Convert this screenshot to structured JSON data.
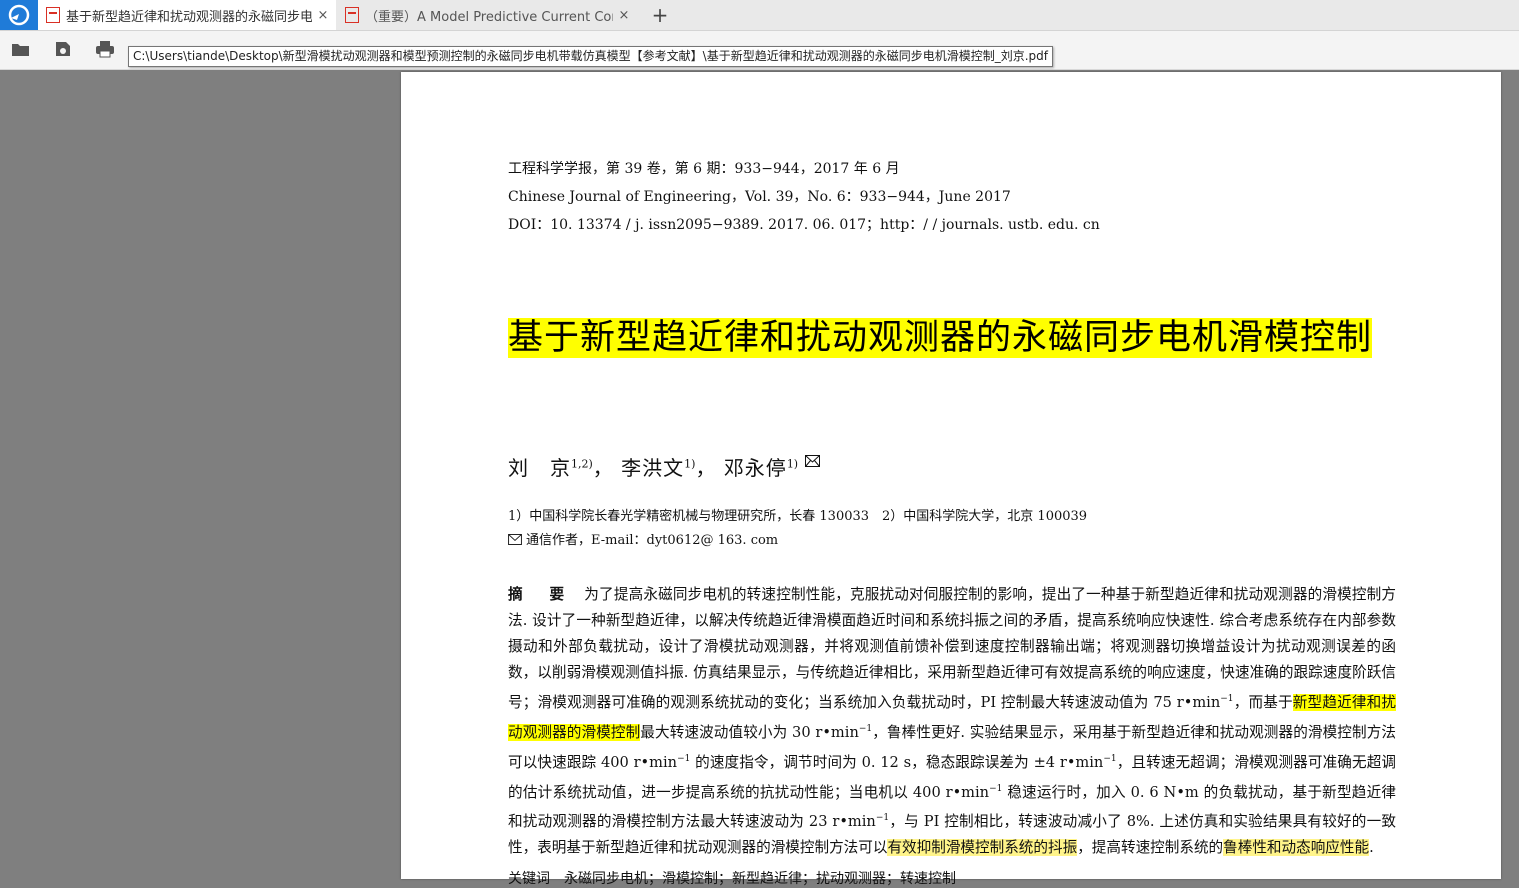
{
  "tabs": [
    {
      "label": "基于新型趋近律和扰动观测器的永磁同步电...",
      "close": "×"
    },
    {
      "label": "（重要）A Model Predictive Current Con...",
      "close": "×"
    }
  ],
  "new_tab": "+",
  "tooltip": "C:\\Users\\tiande\\Desktop\\新型滑模扰动观测器和模型预测控制的永磁同步电机带载仿真模型【参考文献】\\基于新型趋近律和扰动观测器的永磁同步电机滑模控制_刘京.pdf",
  "paper": {
    "header": [
      "工程科学学报，第 39 卷，第 6 期：933−944，2017 年 6 月",
      "Chinese Journal of Engineering，Vol. 39，No. 6：933−944，June 2017",
      "DOI：10. 13374 / j. issn2095−9389. 2017. 06. 017；http：/ / journals. ustb. edu. cn"
    ],
    "title": "基于新型趋近律和扰动观测器的永磁同步电机滑模控制",
    "authors": {
      "a1": "刘　京",
      "a1_sup": "1,2)",
      "a2": "李洪文",
      "a2_sup": "1)",
      "a3": "邓永停",
      "a3_sup": "1)",
      "sep": "，",
      "mail_icon": "envelope-icon"
    },
    "affiliation": "1）中国科学院长春光学精密机械与物理研究所，长春 130033　2）中国科学院大学，北京 100039",
    "corresponding": "通信作者，E-mail：dyt0612@ 163. com",
    "abstract_label": "摘　要",
    "abstract": {
      "p1": "为了提高永磁同步电机的转速控制性能，克服扰动对伺服控制的影响，提出了一种基于新型趋近律和扰动观测器的滑模控制方法. 设计了一种新型趋近律，以解决传统趋近律滑模面趋近时间和系统抖振之间的矛盾，提高系统响应快速性. 综合考虑系统存在内部参数摄动和外部负载扰动，设计了滑模扰动观测器，并将观测值前馈补偿到速度控制器输出端；将观测器切换增益设计为扰动观测误差的函数，以削弱滑模观测值抖振. 仿真结果显示，与传统趋近律相比，采用新型趋近律可有效提高系统的响应速度，快速准确的跟踪速度阶跃信号；滑模观测器可准确的观测系统扰动的变化；当系统加入负载扰动时，PI 控制最大转速波动值为 75 r•min",
      "p1_sup": "−1",
      "p2": "，而基于",
      "hl1": "新型趋近律和扰动观测器的滑模控制",
      "p3": "最大转速波动值较小为 30 r•min",
      "p3_sup": "−1",
      "p4": "，鲁棒性更好. 实验结果显示，采用基于新型趋近律和扰动观测器的滑模控制方法可以快速跟踪 400 r•min",
      "p4_sup": "−1",
      "p5": " 的速度指令，调节时间为 0. 12 s，稳态跟踪误差为 ±4 r•min",
      "p5_sup": "−1",
      "p6": "，且转速无超调；滑模观测器可准确无超调的估计系统扰动值，进一步提高系统的抗扰动性能；当电机以 400 r•min",
      "p6_sup": "−1",
      "p7": " 稳速运行时，加入 0. 6 N•m 的负载扰动，基于新型趋近律和扰动观测器的滑模控制方法最大转速波动为 23 r•min",
      "p7_sup": "−1",
      "p8": "，与 PI 控制相比，转速波动减小了 8%. 上述仿真和实验结果具有较好的一致性，表明基于新型趋近律和扰动观测器的滑模控制方法可以",
      "hl2": "有效抑制滑模控制系统的抖振",
      "p9": "，提高转速控制系统的",
      "hl3": "鲁棒性和动态响应性能",
      "p10": "."
    },
    "keywords_cut": "关键词　永磁同步电机；滑模控制；新型趋近律；扰动观测器；转速控制"
  },
  "colors": {
    "accent": "#1f7bd8",
    "highlight": "#ffff00",
    "highlight_soft": "#fff48a",
    "viewer_bg": "#7f7f7f"
  }
}
